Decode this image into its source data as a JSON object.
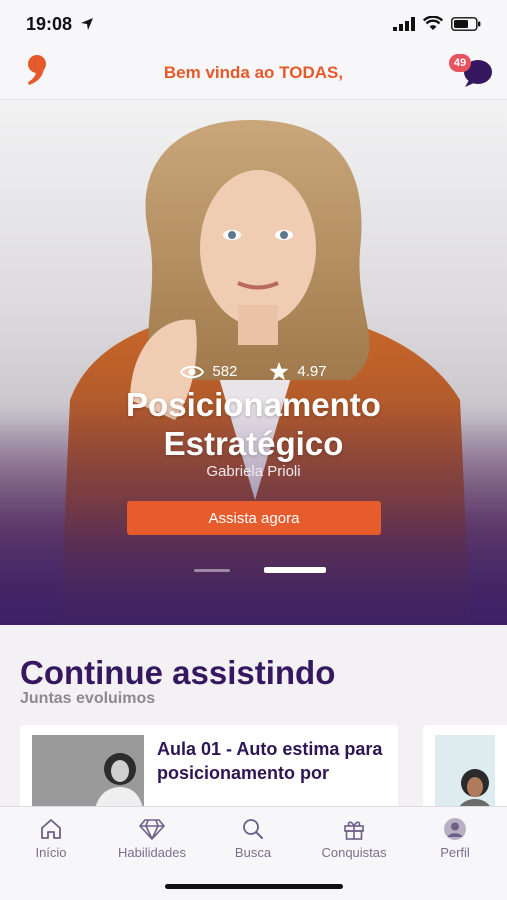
{
  "status": {
    "time": "19:08"
  },
  "header": {
    "welcome": "Bem vinda ao TODAS,",
    "chat_badge": "49",
    "accent": "#e55a2b"
  },
  "hero": {
    "views": "582",
    "rating": "4.97",
    "title_line1": "Posicionamento",
    "title_line2": "Estratégico",
    "author": "Gabriela Prioli",
    "cta": "Assista agora",
    "carousel_active_index": 1,
    "carousel_count": 2
  },
  "continue": {
    "title": "Continue assistindo",
    "subtitle": "Juntas evoluimos",
    "cards": [
      {
        "title": "Aula 01 - Auto estima para posicionamento por"
      }
    ]
  },
  "tabs": [
    {
      "label": "Início",
      "icon": "home-icon"
    },
    {
      "label": "Habilidades",
      "icon": "diamond-icon"
    },
    {
      "label": "Busca",
      "icon": "search-icon"
    },
    {
      "label": "Conquistas",
      "icon": "gift-icon"
    },
    {
      "label": "Perfil",
      "icon": "user-icon"
    }
  ]
}
